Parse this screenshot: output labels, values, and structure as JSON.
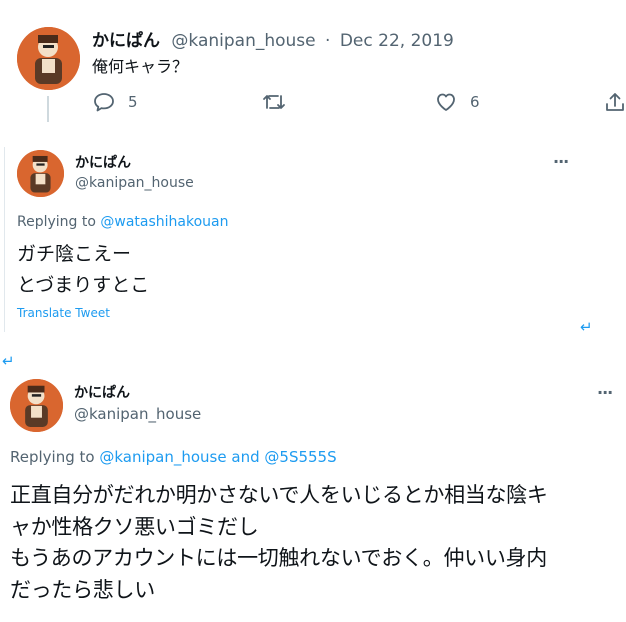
{
  "tweet1": {
    "display_name": "かにぱん",
    "handle": "@kanipan_house",
    "separator": "·",
    "date": "Dec 22, 2019",
    "text": "俺何キャラ？",
    "reply_count": "5",
    "like_count": "6",
    "icons": [
      "reply-icon",
      "retweet-icon",
      "like-icon",
      "share-icon"
    ]
  },
  "tweet2": {
    "display_name": "かにぱん",
    "handle": "@kanipan_house",
    "replying_prefix": "Replying to",
    "replying_to": "@watashihakouan",
    "text_line1": "ガチ陰こえー",
    "text_line2": "とづまりすとこ",
    "translate": "Translate Tweet",
    "more": "···"
  },
  "tweet3": {
    "display_name": "かにぱん",
    "handle": "@kanipan_house",
    "replying_prefix": "Replying to",
    "replying_to_1": "@kanipan_house",
    "replying_and": "and",
    "replying_to_2": "@5S555S",
    "text_line1": "正直自分がだれか明かさないで人をいじるとか相当な陰キ",
    "text_line2": "ャか性格クソ悪いゴミだし",
    "text_line3": "もうあのアカウントには一切触れないでおく。仲いい身内",
    "text_line4": "だったら悲しい",
    "more": "···"
  },
  "return_glyph": "↵",
  "colors": {
    "accent": "#1d9bf0",
    "text": "#0f1419",
    "muted": "#536471",
    "avatar": "#d9662f"
  }
}
